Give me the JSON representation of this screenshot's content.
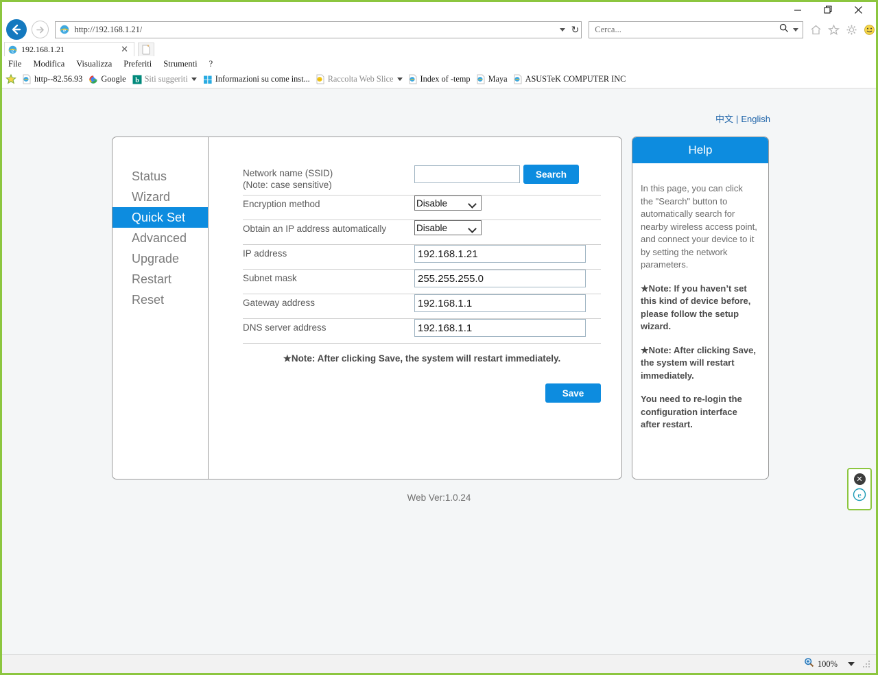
{
  "window": {
    "minimize": "—",
    "restore": "❐",
    "close": "✕"
  },
  "browser": {
    "address_value": "http://192.168.1.21/",
    "search_placeholder": "Cerca...",
    "back_icon": "back-arrow-icon",
    "forward_icon": "forward-arrow-icon",
    "refresh_icon": "refresh-icon",
    "tab": {
      "title": "192.168.1.21",
      "close": "✕"
    },
    "toolbar_icons": [
      "home-icon",
      "favorites-star-icon",
      "gear-icon",
      "smiley-icon"
    ],
    "menu": [
      "File",
      "Modifica",
      "Visualizza",
      "Preferiti",
      "Strumenti",
      "?"
    ],
    "bookmarks": [
      {
        "label": "http--82.56.93",
        "icon": "ie-page-icon",
        "muted": false,
        "caret": false
      },
      {
        "label": "Google",
        "icon": "google-g-icon",
        "muted": false,
        "caret": false
      },
      {
        "label": "Siti suggeriti",
        "icon": "bing-b-icon",
        "muted": true,
        "caret": true
      },
      {
        "label": "Informazioni su come inst...",
        "icon": "windows-icon",
        "muted": false,
        "caret": false
      },
      {
        "label": "Raccolta Web Slice",
        "icon": "ie-page-icon",
        "muted": true,
        "caret": true
      },
      {
        "label": "Index of -temp",
        "icon": "ie-page-icon",
        "muted": false,
        "caret": false
      },
      {
        "label": "Maya",
        "icon": "ie-page-icon",
        "muted": false,
        "caret": false
      },
      {
        "label": "ASUSTeK COMPUTER INC",
        "icon": "ie-page-icon",
        "muted": false,
        "caret": false
      }
    ]
  },
  "page": {
    "language": {
      "chinese": "中文",
      "separator": "|",
      "english": "English"
    },
    "nav": [
      {
        "label": "Status",
        "active": false
      },
      {
        "label": "Wizard",
        "active": false
      },
      {
        "label": "Quick Set",
        "active": true
      },
      {
        "label": "Advanced",
        "active": false
      },
      {
        "label": "Upgrade",
        "active": false
      },
      {
        "label": "Restart",
        "active": false
      },
      {
        "label": "Reset",
        "active": false
      }
    ],
    "form": {
      "ssid_label_line1": "Network name (SSID)",
      "ssid_label_line2": "(Note: case sensitive)",
      "ssid_value": "",
      "search_button": "Search",
      "encryption_label": "Encryption method",
      "encryption_value": "Disable",
      "encryption_options": [
        "Disable"
      ],
      "dhcp_label": "Obtain an IP address automatically",
      "dhcp_value": "Disable",
      "dhcp_options": [
        "Disable"
      ],
      "ip_label": "IP address",
      "ip_value": "192.168.1.21",
      "subnet_label": "Subnet mask",
      "subnet_value": "255.255.255.0",
      "gateway_label": "Gateway address",
      "gateway_value": "192.168.1.1",
      "dns_label": "DNS server address",
      "dns_value": "192.168.1.1",
      "note": "★Note: After clicking Save, the system will restart immediately.",
      "save_button": "Save"
    },
    "help": {
      "title": "Help",
      "paragraph1": "In this page, you can click the \"Search\" button to automatically search for nearby wireless access point, and connect your device to it by setting the network parameters.",
      "note1": "★Note: If you haven’t set this kind of device before, please follow the setup wizard.",
      "note2": "★Note: After clicking Save, the system will restart immediately.",
      "note3": "You need to re-login the configuration interface after restart."
    },
    "footer": "Web Ver:1.0.24",
    "widget": {
      "close": "✕",
      "icon": "ie-logo-icon"
    }
  },
  "status": {
    "zoom_icon": "zoom-magnifier-icon",
    "zoom_level": "100%"
  },
  "colors": {
    "accent_blue": "#0d8cdf",
    "window_border_green": "#8cc63f",
    "link_blue": "#1c62a8",
    "page_background": "#f4f6f7"
  }
}
